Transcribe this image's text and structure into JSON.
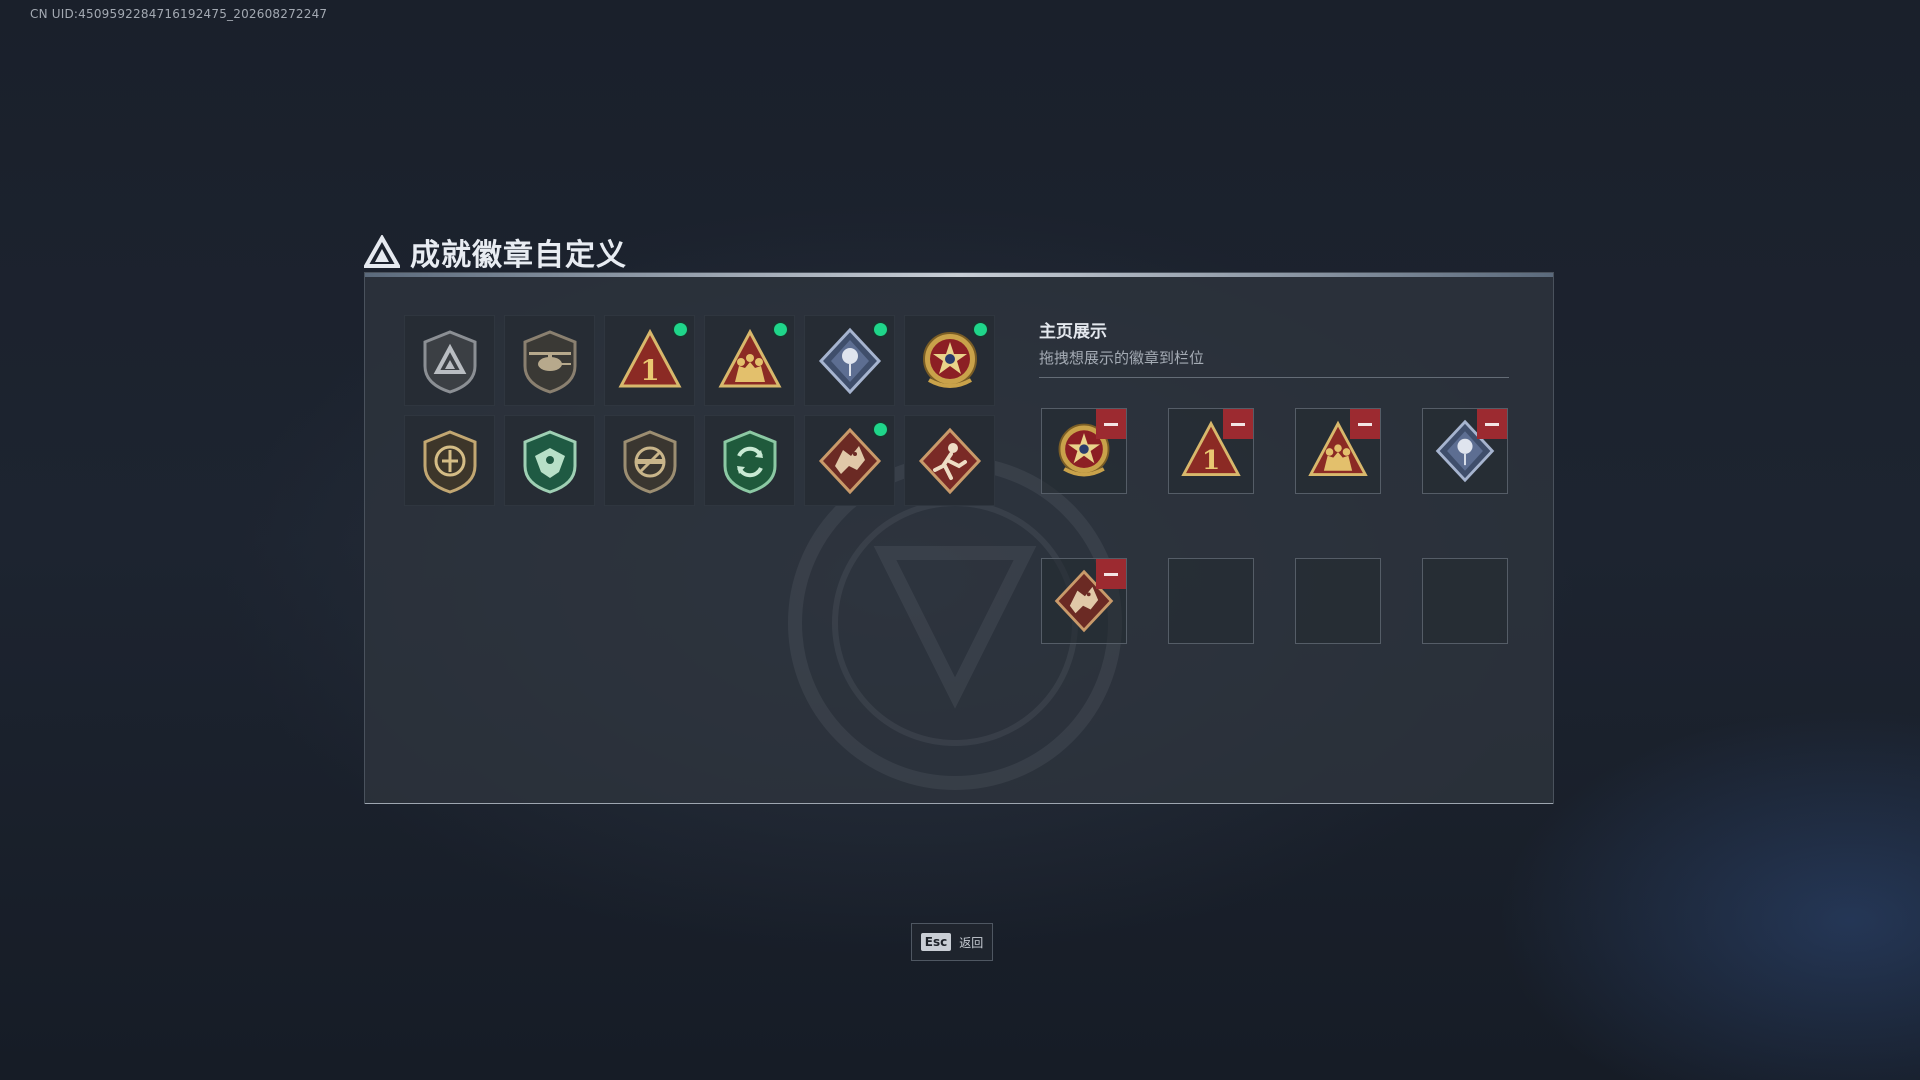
{
  "uid_text": "CN UID:4509592284716192475_202608272247",
  "page_title": "成就徽章自定义",
  "right_panel": {
    "title": "主页展示",
    "subtitle": "拖拽想展示的徽章到栏位"
  },
  "esc": {
    "key": "Esc",
    "label": "返回"
  },
  "colors": {
    "new_dot": "#1fd68a",
    "remove": "#9c2a30"
  },
  "badges": [
    {
      "icon": "shield-delta-badge-icon",
      "new": false
    },
    {
      "icon": "helicopter-badge-icon",
      "new": false
    },
    {
      "icon": "number-one-triangle-badge-icon",
      "new": true
    },
    {
      "icon": "squad-triangle-badge-icon",
      "new": true
    },
    {
      "icon": "rose-diamond-badge-icon",
      "new": true
    },
    {
      "icon": "star-medal-badge-icon",
      "new": true
    },
    {
      "icon": "crest-shield-badge-icon",
      "new": false
    },
    {
      "icon": "green-eagle-badge-icon",
      "new": false
    },
    {
      "icon": "no-weapon-badge-icon",
      "new": false
    },
    {
      "icon": "recycle-shield-badge-icon",
      "new": false
    },
    {
      "icon": "dragon-diamond-badge-icon",
      "new": true
    },
    {
      "icon": "runner-diamond-badge-icon",
      "new": false
    }
  ],
  "showcase_slots": [
    {
      "icon": "star-medal-badge-icon",
      "filled": true
    },
    {
      "icon": "number-one-triangle-badge-icon",
      "filled": true
    },
    {
      "icon": "squad-triangle-badge-icon",
      "filled": true
    },
    {
      "icon": "rose-diamond-badge-icon",
      "filled": true
    },
    {
      "icon": "dragon-diamond-badge-icon",
      "filled": true
    },
    {
      "icon": "",
      "filled": false
    },
    {
      "icon": "",
      "filled": false
    },
    {
      "icon": "",
      "filled": false
    }
  ]
}
